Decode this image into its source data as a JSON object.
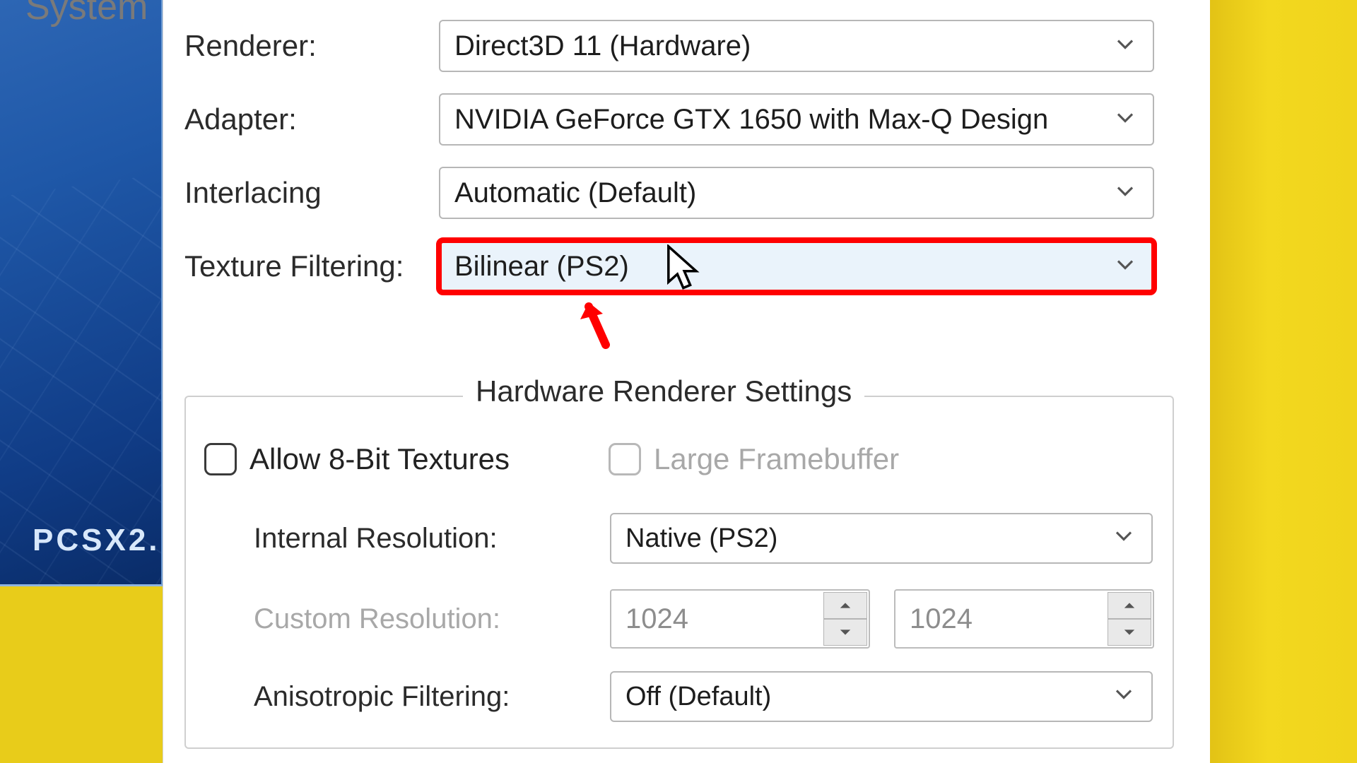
{
  "app": {
    "name_fragment": "PCSX2."
  },
  "menu": {
    "system": "System"
  },
  "settings": {
    "renderer": {
      "label": "Renderer:",
      "value": "Direct3D 11 (Hardware)"
    },
    "adapter": {
      "label": "Adapter:",
      "value": "NVIDIA GeForce GTX 1650 with Max-Q Design"
    },
    "interlacing": {
      "label": "Interlacing",
      "value": "Automatic (Default)"
    },
    "texture_filtering": {
      "label": "Texture Filtering:",
      "value": "Bilinear (PS2)"
    }
  },
  "hardware": {
    "group_title": "Hardware Renderer Settings",
    "allow_8bit": {
      "label": "Allow 8-Bit Textures",
      "checked": false
    },
    "large_framebuffer": {
      "label": "Large Framebuffer",
      "checked": false,
      "disabled": true
    },
    "internal_resolution": {
      "label": "Internal Resolution:",
      "value": "Native (PS2)"
    },
    "custom_resolution": {
      "label": "Custom Resolution:",
      "w": "1024",
      "h": "1024",
      "disabled": true
    },
    "anisotropic": {
      "label": "Anisotropic Filtering:",
      "value": "Off (Default)"
    }
  },
  "annotation": {
    "highlight_color": "#ff0000"
  }
}
